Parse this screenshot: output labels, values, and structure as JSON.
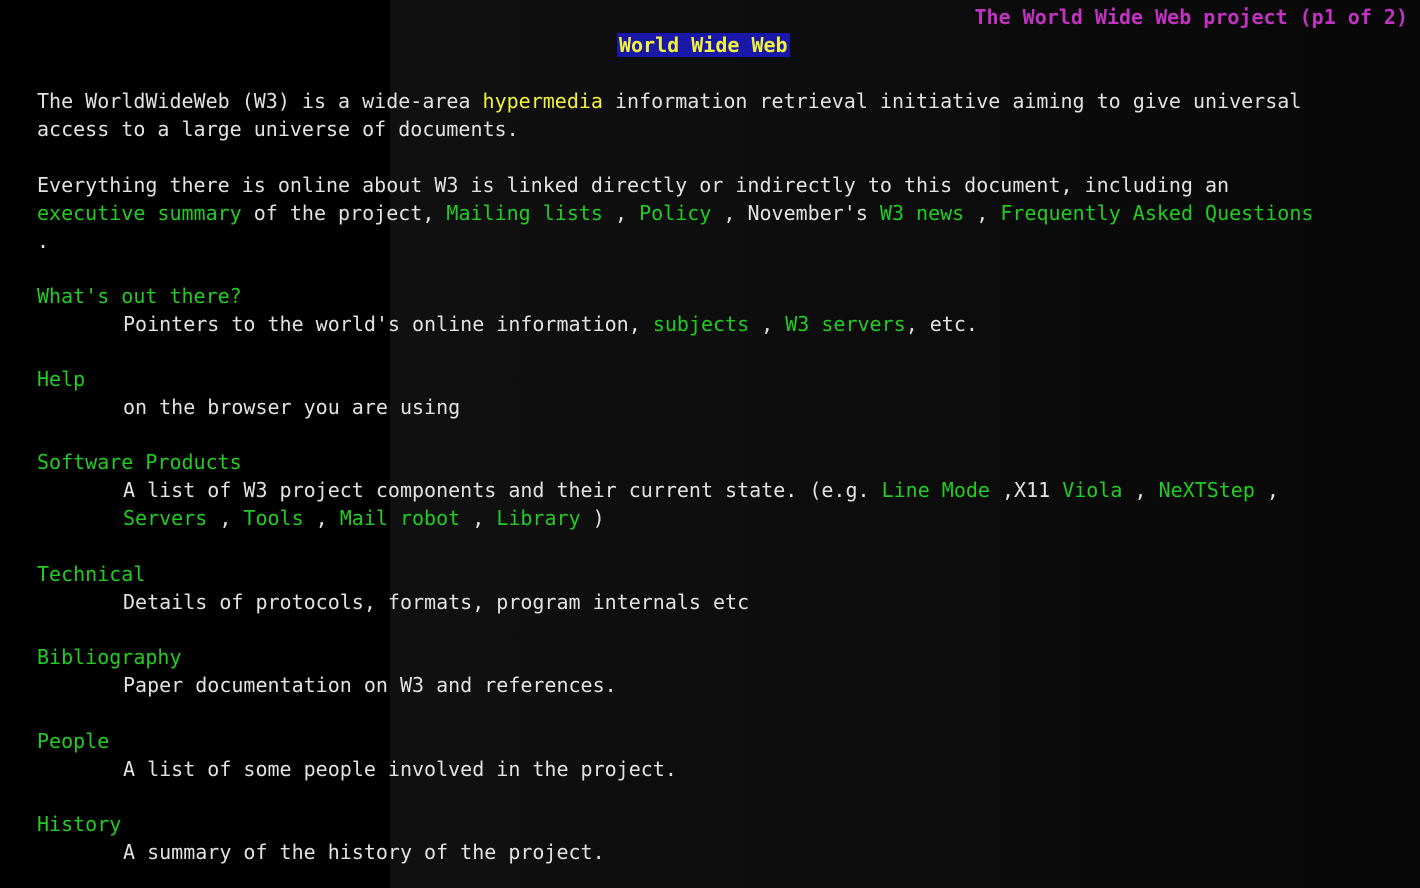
{
  "status": {
    "page_indicator": "The World Wide Web project (p1 of 2)"
  },
  "title": "World Wide Web",
  "intro": {
    "l1_pre": "The WorldWideWeb (W3) is a wide-area ",
    "l1_link": "hypermedia",
    "l1_post": " information retrieval initiative aiming to give universal",
    "l2": "access to a large universe of documents."
  },
  "everything": {
    "l1": "Everything there is online about W3 is linked directly or indirectly to this document, including an",
    "exec_summary": "executive summary",
    "sep1": " of the project, ",
    "mailing_lists": "Mailing lists",
    "sep2": " , ",
    "policy": "Policy",
    "sep3": " , November's ",
    "w3_news": "W3 news",
    "sep4": " , ",
    "faq": "Frequently Asked Questions",
    "end": "."
  },
  "sections": {
    "whats_out": {
      "heading": "What's out there?",
      "pre": "Pointers to the world's online information, ",
      "subjects": "subjects",
      "sep": " , ",
      "servers": "W3 servers",
      "post": ", etc."
    },
    "help": {
      "heading": "Help",
      "desc": "on the browser you are using"
    },
    "software": {
      "heading": "Software Products",
      "pre": "A list of W3 project components and their current state. (e.g. ",
      "line_mode": "Line Mode",
      "sep1": " ,X11 ",
      "viola": "Viola",
      "sep2": " , ",
      "nextstep": "NeXTStep",
      "sep3": " ,",
      "servers": "Servers",
      "sep4": " , ",
      "tools": "Tools",
      "sep5": " , ",
      "mail_robot": "Mail robot",
      "sep6": " , ",
      "library": "Library",
      "end": " )"
    },
    "technical": {
      "heading": "Technical",
      "desc": "Details of protocols, formats, program internals etc"
    },
    "bibliography": {
      "heading": "Bibliography",
      "desc": "Paper documentation on W3 and references."
    },
    "people": {
      "heading": "People",
      "desc": "A list of some people involved in the project."
    },
    "history": {
      "heading": "History",
      "desc": "A summary of the history of the project."
    }
  },
  "colors": {
    "background": "#000000",
    "text": "#e2e2e2",
    "link": "#22cc22",
    "highlight_link": "#f2f23a",
    "title_bg": "#1a18a8",
    "status": "#c233c2"
  }
}
